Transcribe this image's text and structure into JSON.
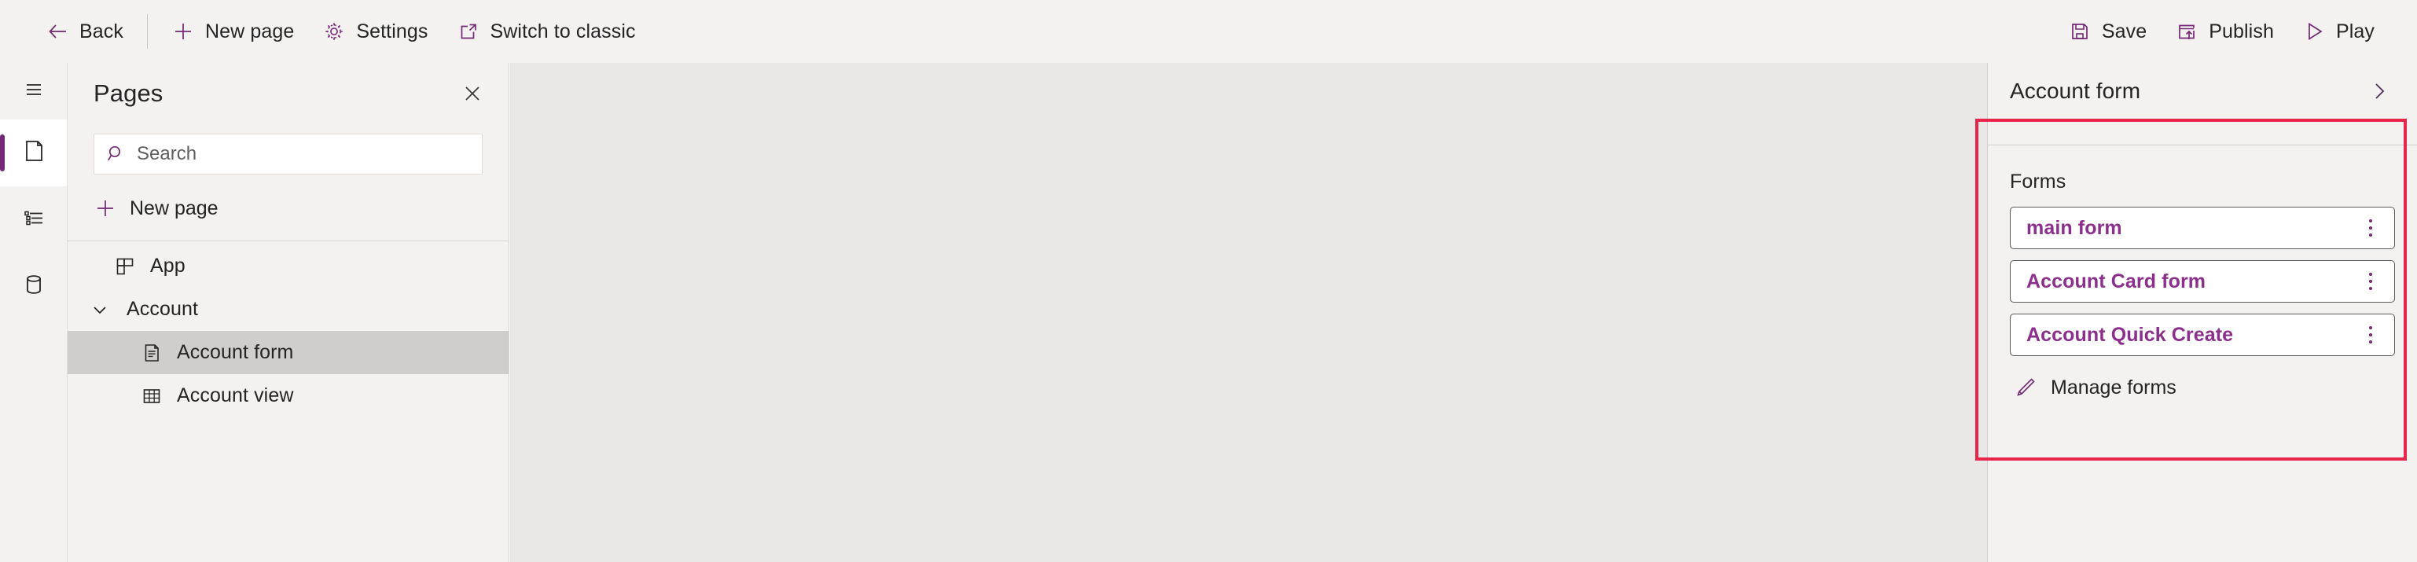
{
  "toolbar": {
    "left_commands": [
      {
        "id": "back",
        "label": "Back",
        "icon": "arrow-left-icon"
      },
      {
        "id": "newpage",
        "label": "New page",
        "icon": "plus-icon"
      },
      {
        "id": "settings",
        "label": "Settings",
        "icon": "gear-icon"
      },
      {
        "id": "classic",
        "label": "Switch to classic",
        "icon": "open-in-new-icon"
      }
    ],
    "right_commands": [
      {
        "id": "save",
        "label": "Save",
        "icon": "save-icon"
      },
      {
        "id": "publish",
        "label": "Publish",
        "icon": "publish-icon"
      },
      {
        "id": "play",
        "label": "Play",
        "icon": "play-icon"
      }
    ]
  },
  "rail": {
    "items": [
      {
        "id": "menu",
        "icon": "hamburger-icon",
        "active": false
      },
      {
        "id": "pages",
        "icon": "page-icon",
        "active": true
      },
      {
        "id": "nav",
        "icon": "navigation-icon",
        "active": false
      },
      {
        "id": "data",
        "icon": "database-icon",
        "active": false
      }
    ]
  },
  "pages_panel": {
    "title": "Pages",
    "close_label": "Close",
    "search": {
      "placeholder": "Search",
      "value": ""
    },
    "new_page_label": "New page",
    "tree": [
      {
        "label": "App",
        "icon": "app-grid-icon",
        "level": 1,
        "selected": false,
        "chevron": "none"
      },
      {
        "label": "Account",
        "icon": "none",
        "level": 2,
        "selected": false,
        "chevron": "down"
      },
      {
        "label": "Account form",
        "icon": "form-icon",
        "level": 3,
        "selected": true,
        "chevron": "none"
      },
      {
        "label": "Account view",
        "icon": "table-icon",
        "level": 3,
        "selected": false,
        "chevron": "none"
      }
    ]
  },
  "right_panel": {
    "title": "Account form",
    "expand_label": "Expand",
    "section_label": "Forms",
    "forms": [
      {
        "name": "main form",
        "menu": "more-options"
      },
      {
        "name": "Account Card form",
        "menu": "more-options"
      },
      {
        "name": "Account Quick Create",
        "menu": "more-options"
      }
    ],
    "manage_label": "Manage forms"
  },
  "colors": {
    "accent": "#742774",
    "form_link": "#8c2f8c",
    "chrome_bg": "#f3f2f1",
    "canvas_bg": "#e9e8e7",
    "selected_row": "#cfcecd",
    "annotation": "#e8264b"
  }
}
